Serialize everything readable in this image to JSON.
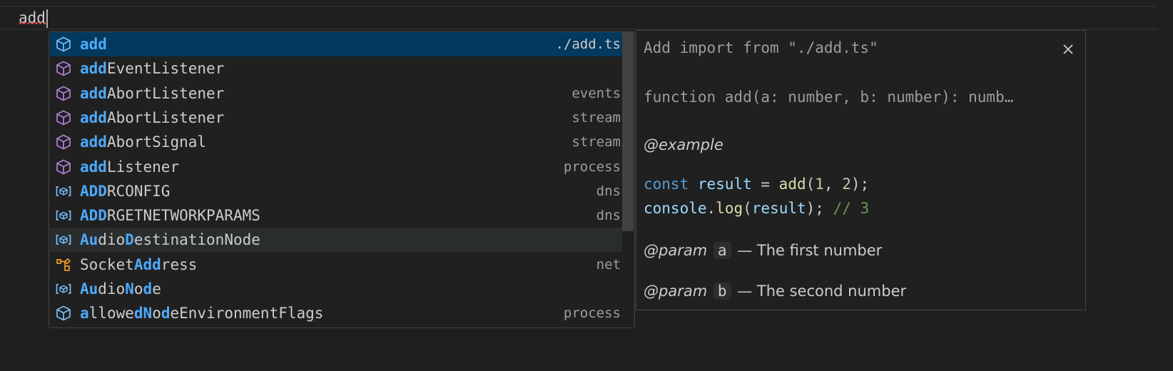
{
  "editor": {
    "typed": "add"
  },
  "suggest": {
    "items": [
      {
        "pre": "",
        "match": "add",
        "post": "",
        "detail": "./add.ts",
        "icon": "module-icon",
        "state": "selected"
      },
      {
        "pre": "",
        "match": "add",
        "post": "EventListener",
        "detail": "",
        "icon": "method-icon",
        "state": ""
      },
      {
        "pre": "",
        "match": "add",
        "post": "AbortListener",
        "detail": "events",
        "icon": "method-icon",
        "state": ""
      },
      {
        "pre": "",
        "match": "add",
        "post": "AbortListener",
        "detail": "stream",
        "icon": "method-icon",
        "state": ""
      },
      {
        "pre": "",
        "match": "add",
        "post": "AbortSignal",
        "detail": "stream",
        "icon": "method-icon",
        "state": ""
      },
      {
        "pre": "",
        "match": "add",
        "post": "Listener",
        "detail": "process",
        "icon": "method-icon",
        "state": ""
      },
      {
        "pre": "",
        "match": "ADD",
        "post": "RCONFIG",
        "detail": "dns",
        "icon": "variable-icon",
        "state": ""
      },
      {
        "pre": "",
        "match": "ADD",
        "post": "RGETNETWORKPARAMS",
        "detail": "dns",
        "icon": "variable-icon",
        "state": ""
      },
      {
        "pre": "",
        "match": "AudioD",
        "post": "estinationNode",
        "detail": "",
        "icon": "variable-icon",
        "state": "hovered"
      },
      {
        "pre": "Socket",
        "match": "Add",
        "post": "ress",
        "detail": "net",
        "icon": "class-icon",
        "state": ""
      },
      {
        "pre": "",
        "match": "AudioNode",
        "post": "",
        "detail": "",
        "icon": "variable-icon",
        "state": ""
      },
      {
        "pre": "",
        "match": "allowedNodeEnvironmentFlags",
        "post": "",
        "detail": "process",
        "icon": "module-icon",
        "state": ""
      }
    ]
  },
  "details": {
    "title": "Add import from \"./add.ts\"",
    "signature": "function add(a: number, b: number): numb…",
    "example_tag": "@example",
    "code_line1": {
      "kw": "const",
      "var": "result",
      "eq": " = ",
      "fn": "add",
      "args": "(",
      "n1": "1",
      "comma": ", ",
      "n2": "2",
      "end": ");"
    },
    "code_line2": {
      "obj": "console",
      "dot": ".",
      "fn": "log",
      "open": "(",
      "var": "result",
      "close": "); ",
      "comment": "// 3"
    },
    "param_tag": "@param",
    "param_a_name": "a",
    "param_a_desc": "— The first number",
    "param_b_name": "b",
    "param_b_desc": "— The second number",
    "close_icon": "close-icon"
  }
}
